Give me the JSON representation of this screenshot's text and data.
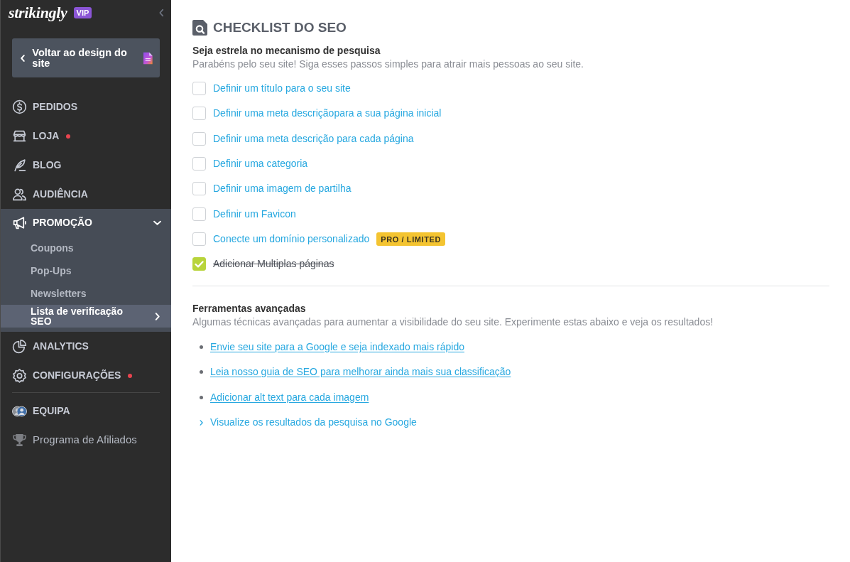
{
  "sidebar": {
    "logo": "strikingly",
    "plan_badge": "VIP",
    "back_button": "Voltar ao design do site",
    "nav": [
      {
        "label": "PEDIDOS",
        "notification": false
      },
      {
        "label": "LOJA",
        "notification": true
      },
      {
        "label": "BLOG",
        "notification": false
      },
      {
        "label": "AUDIÊNCIA",
        "notification": false
      },
      {
        "label": "PROMOÇÃO",
        "notification": false,
        "expanded": true,
        "children": [
          {
            "label": "Coupons",
            "selected": false
          },
          {
            "label": "Pop-Ups",
            "selected": false
          },
          {
            "label": "Newsletters",
            "selected": false
          },
          {
            "label": "Lista de verificação SEO",
            "selected": true
          }
        ]
      },
      {
        "label": "ANALYTICS",
        "notification": false
      },
      {
        "label": "CONFIGURAÇÕES",
        "notification": true
      }
    ],
    "footer_nav": [
      {
        "label": "EQUIPA",
        "kind": "section"
      },
      {
        "label": "Programa de Afiliados",
        "kind": "link"
      }
    ]
  },
  "seo_checklist": {
    "title": "CHECKLIST DO SEO",
    "heading": "Seja estrela no mecanismo de pesquisa",
    "description": "Parabéns pelo seu site! Siga esses passos simples para atrair mais pessoas ao seu site.",
    "tasks": [
      {
        "label": "Definir um título para o seu site",
        "checked": false
      },
      {
        "label": "Definir uma meta descriçãopara a sua página inicial",
        "checked": false
      },
      {
        "label": "Definir uma meta descrição para cada página",
        "checked": false
      },
      {
        "label": "Definir uma categoria",
        "checked": false
      },
      {
        "label": "Definir uma imagem de partilha",
        "checked": false
      },
      {
        "label": "Definir um Favicon",
        "checked": false
      },
      {
        "label": "Conecte um domínio personalizado",
        "checked": false,
        "badge": "PRO / LIMITED"
      },
      {
        "label": "Adicionar Multiplas páginas",
        "checked": true
      }
    ]
  },
  "advanced_tools": {
    "heading": "Ferramentas avançadas",
    "description": "Algumas técnicas avançadas para aumentar a visibilidade do seu site. Experimente estas abaixo e veja os resultados!",
    "links": [
      {
        "label": "Envie seu site para a Google e seja indexado mais rápido",
        "kind": "bullet"
      },
      {
        "label": "Leia nosso guia de SEO para melhorar ainda mais sua classificação",
        "kind": "bullet"
      },
      {
        "label": "Adicionar alt text para cada imagem",
        "kind": "bullet"
      },
      {
        "label": "Visualize os resultados da pesquisa no Google",
        "kind": "expander",
        "expanded": false
      }
    ]
  }
}
